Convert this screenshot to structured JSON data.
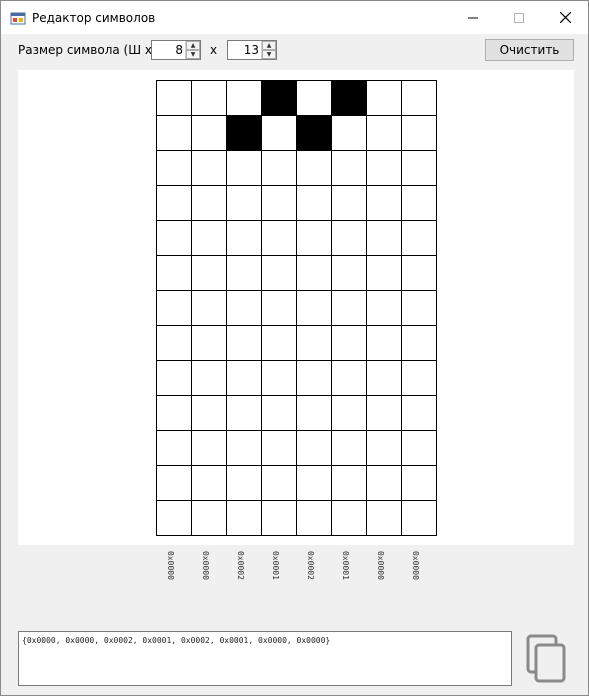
{
  "window": {
    "title": "Редактор символов",
    "minimize_icon": "minimize-icon",
    "maximize_icon": "maximize-icon",
    "close_icon": "close-icon"
  },
  "toolbar": {
    "size_label": "Размер символа (Ш x В)",
    "width_value": "8",
    "times": "x",
    "height_value": "13",
    "clear_label": "Очистить"
  },
  "grid": {
    "columns": 8,
    "rows": 13,
    "filled_cells": [
      {
        "row": 0,
        "col": 3
      },
      {
        "row": 0,
        "col": 5
      },
      {
        "row": 1,
        "col": 2
      },
      {
        "row": 1,
        "col": 4
      }
    ]
  },
  "column_codes": [
    "0x0000",
    "0x0000",
    "0x0002",
    "0x0001",
    "0x0002",
    "0x0001",
    "0x0000",
    "0x0000"
  ],
  "output": {
    "text": "{0x0000, 0x0000, 0x0002, 0x0001, 0x0002, 0x0001, 0x0000, 0x0000}"
  },
  "copy_button": {
    "icon": "copy-icon"
  }
}
